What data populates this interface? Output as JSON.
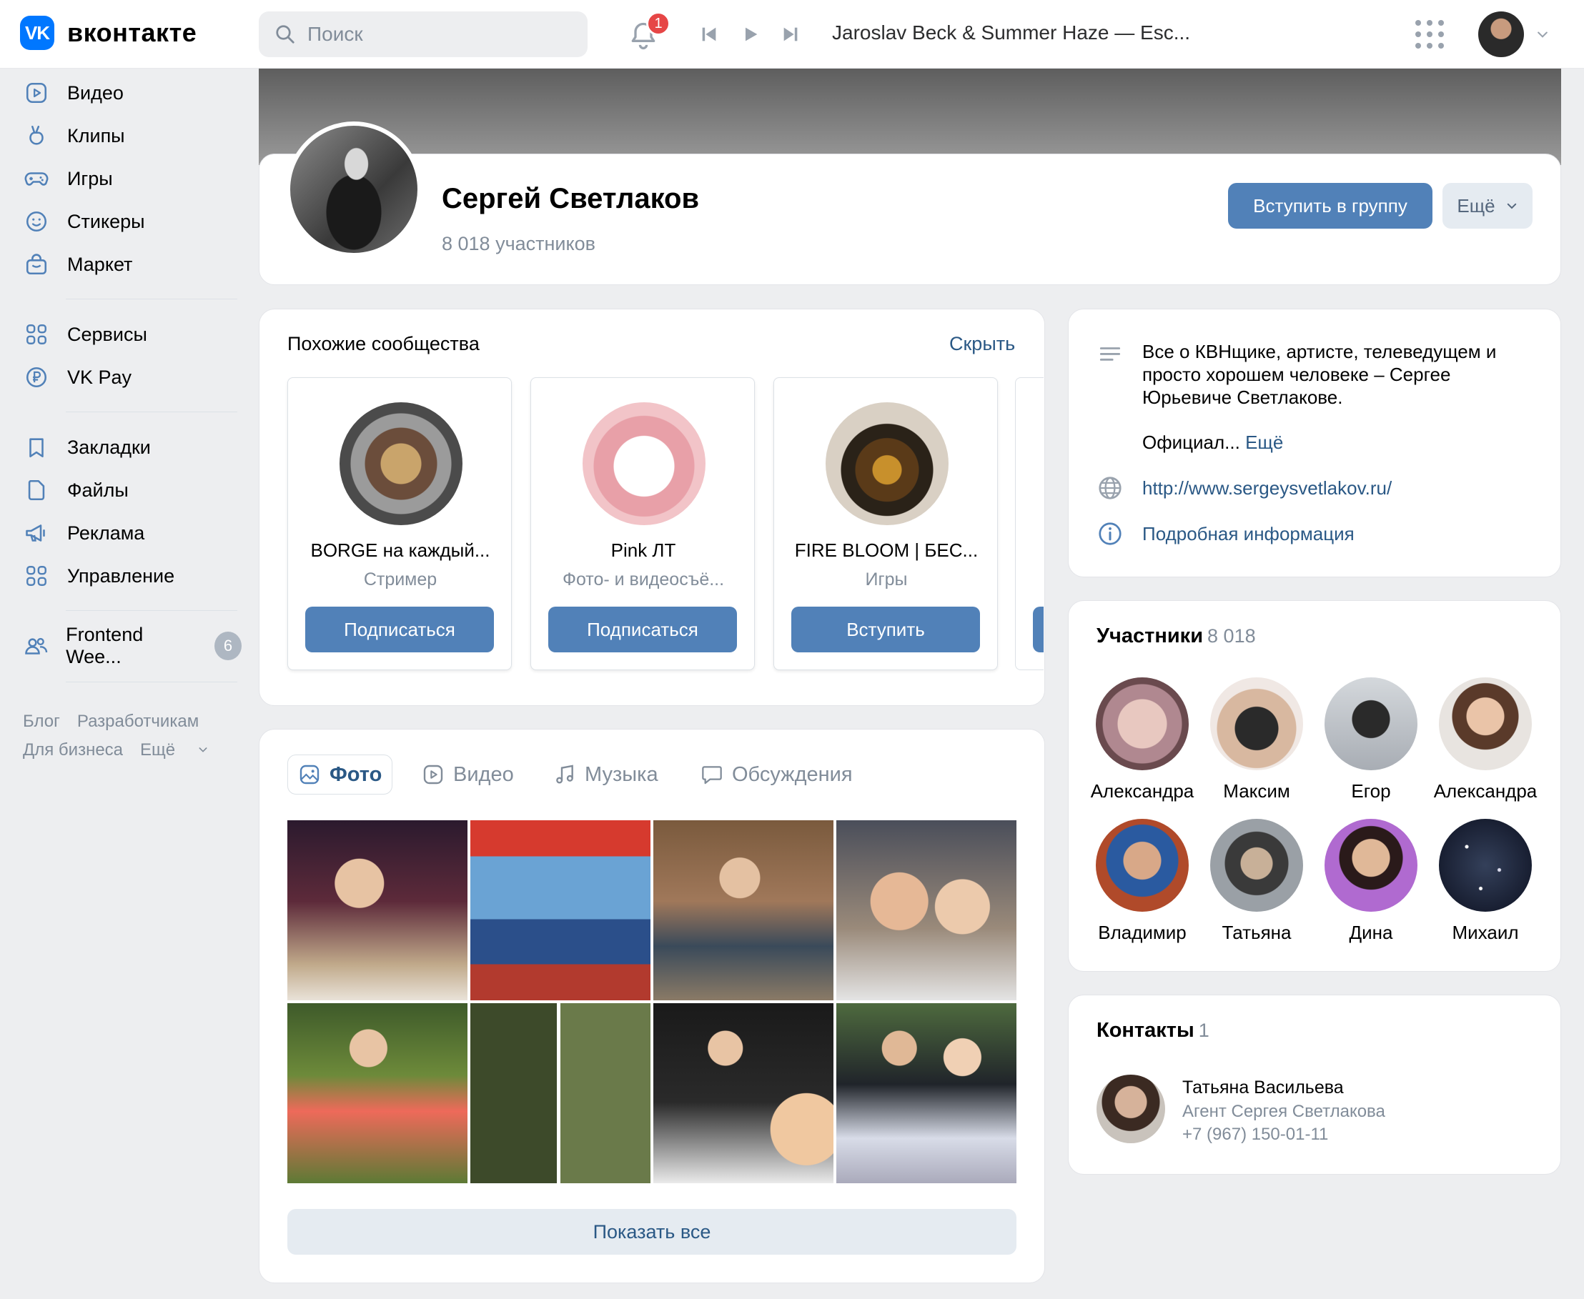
{
  "header": {
    "logo_mark": "VK",
    "logo_text": "вконтакте",
    "search_placeholder": "Поиск",
    "notifications_count": "1",
    "now_playing": "Jaroslav Beck & Summer Haze — Esc..."
  },
  "sidebar": {
    "items": [
      {
        "label": "Видео",
        "icon": "video-icon"
      },
      {
        "label": "Клипы",
        "icon": "clips-icon"
      },
      {
        "label": "Игры",
        "icon": "gamepad-icon"
      },
      {
        "label": "Стикеры",
        "icon": "smile-icon"
      },
      {
        "label": "Маркет",
        "icon": "shopping-bag-icon"
      },
      {
        "label": "Сервисы",
        "icon": "grid-icon"
      },
      {
        "label": "VK Pay",
        "icon": "ruble-icon"
      },
      {
        "label": "Закладки",
        "icon": "bookmark-icon"
      },
      {
        "label": "Файлы",
        "icon": "file-icon"
      },
      {
        "label": "Реклама",
        "icon": "megaphone-icon"
      },
      {
        "label": "Управление",
        "icon": "grid-icon"
      },
      {
        "label": "Frontend Wee...",
        "icon": "users-icon",
        "badge": "6"
      }
    ],
    "footer": [
      "Блог",
      "Разработчикам",
      "Для бизнеса",
      "Ещё"
    ]
  },
  "group": {
    "name": "Сергей Светлаков",
    "members": "8 018 участников",
    "join_label": "Вступить в группу",
    "more_label": "Ещё"
  },
  "similar": {
    "title": "Похожие сообщества",
    "hide_label": "Скрыть",
    "items": [
      {
        "name": "BORGE на каждый...",
        "subtitle": "Стример",
        "button": "Подписаться"
      },
      {
        "name": "Pink ЛТ",
        "subtitle": "Фото- и видеосъё...",
        "button": "Подписаться"
      },
      {
        "name": "FIRE BLOOM | БЕС...",
        "subtitle": "Игры",
        "button": "Вступить"
      }
    ]
  },
  "media": {
    "tabs": [
      "Фото",
      "Видео",
      "Музыка",
      "Обсуждения"
    ],
    "show_all": "Показать все"
  },
  "about": {
    "description": "Все о КВНщике, артисте, телеведущем и просто хорошем человеке – Сергее Юрьевиче Светлакове.",
    "official_prefix": "Официал...",
    "more_link": "Ещё",
    "website": "http://www.sergeysvetlakov.ru/",
    "details_link": "Подробная информация"
  },
  "members": {
    "title": "Участники",
    "count": "8 018",
    "list": [
      "Александра",
      "Максим",
      "Егор",
      "Александра",
      "Владимир",
      "Татьяна",
      "Дина",
      "Михаил"
    ]
  },
  "contacts": {
    "title": "Контакты",
    "count": "1",
    "name": "Татьяна Васильева",
    "role": "Агент Сергея Светлакова",
    "phone": "+7 (967) 150-01-11"
  },
  "colors": {
    "accent": "#5181b8",
    "link": "#2a5885",
    "brand": "#0077ff",
    "badge": "#e64646",
    "background": "#edeef0"
  }
}
